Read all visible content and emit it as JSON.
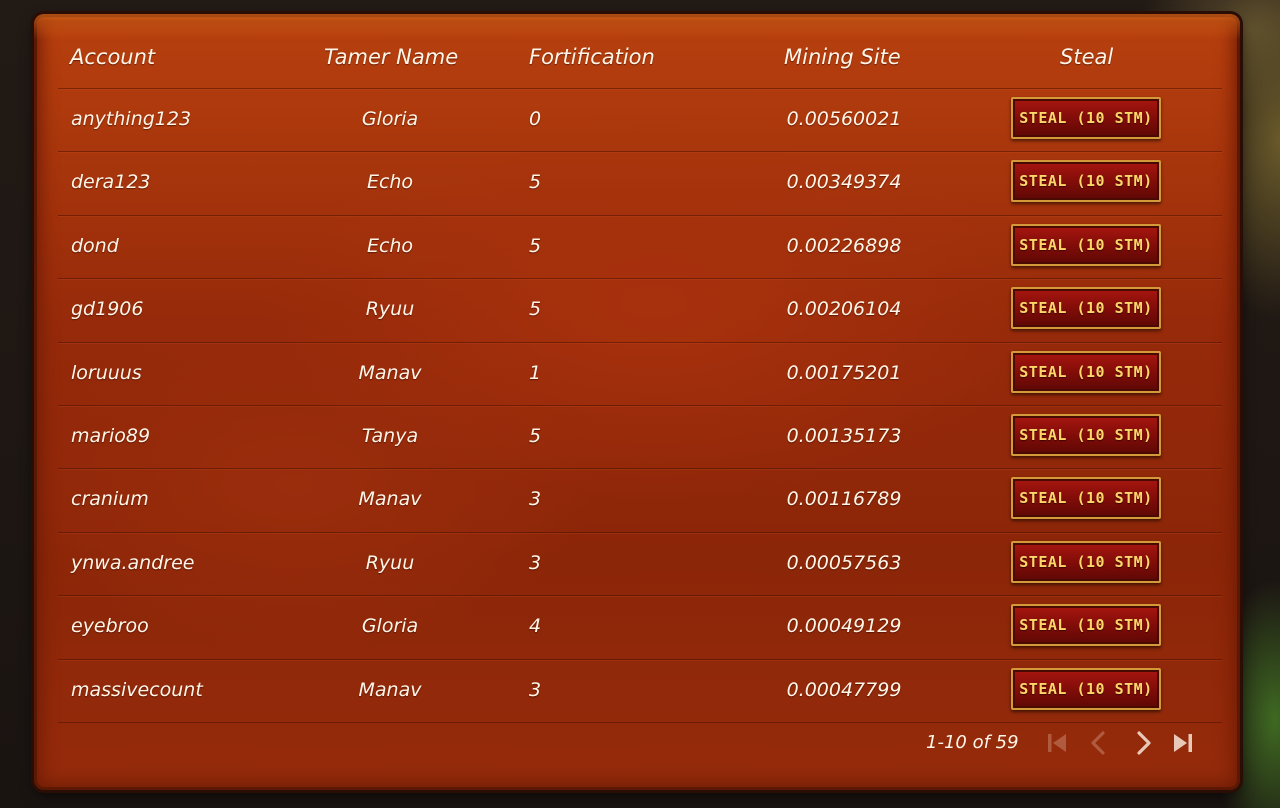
{
  "table": {
    "headers": {
      "account": "Account",
      "tamer_name": "Tamer Name",
      "fortification": "Fortification",
      "mining_site": "Mining Site",
      "steal": "Steal"
    },
    "rows": [
      {
        "account": "anything123",
        "tamer_name": "Gloria",
        "fortification": "0",
        "mining_site": "0.00560021",
        "steal_label": "STEAL (10 STM)"
      },
      {
        "account": "dera123",
        "tamer_name": "Echo",
        "fortification": "5",
        "mining_site": "0.00349374",
        "steal_label": "STEAL (10 STM)"
      },
      {
        "account": "dond",
        "tamer_name": "Echo",
        "fortification": "5",
        "mining_site": "0.00226898",
        "steal_label": "STEAL (10 STM)"
      },
      {
        "account": "gd1906",
        "tamer_name": "Ryuu",
        "fortification": "5",
        "mining_site": "0.00206104",
        "steal_label": "STEAL (10 STM)"
      },
      {
        "account": "loruuus",
        "tamer_name": "Manav",
        "fortification": "1",
        "mining_site": "0.00175201",
        "steal_label": "STEAL (10 STM)"
      },
      {
        "account": "mario89",
        "tamer_name": "Tanya",
        "fortification": "5",
        "mining_site": "0.00135173",
        "steal_label": "STEAL (10 STM)"
      },
      {
        "account": "cranium",
        "tamer_name": "Manav",
        "fortification": "3",
        "mining_site": "0.00116789",
        "steal_label": "STEAL (10 STM)"
      },
      {
        "account": "ynwa.andree",
        "tamer_name": "Ryuu",
        "fortification": "3",
        "mining_site": "0.00057563",
        "steal_label": "STEAL (10 STM)"
      },
      {
        "account": "eyebroo",
        "tamer_name": "Gloria",
        "fortification": "4",
        "mining_site": "0.00049129",
        "steal_label": "STEAL (10 STM)"
      },
      {
        "account": "massivecount",
        "tamer_name": "Manav",
        "fortification": "3",
        "mining_site": "0.00047799",
        "steal_label": "STEAL (10 STM)"
      }
    ]
  },
  "pagination": {
    "range_text": "1-10 of 59",
    "icons": {
      "first": "first-page-icon",
      "prev": "chevron-left-icon",
      "next": "chevron-right-icon",
      "last": "last-page-icon"
    }
  },
  "colors": {
    "panel": "#962a0a",
    "text": "#fff6e8",
    "button_fill": "#8a0f0a",
    "button_border": "#d49a3a",
    "button_text": "#ffd66a",
    "pager_disabled": "#b05a40",
    "pager_enabled": "#e8c9b8"
  }
}
